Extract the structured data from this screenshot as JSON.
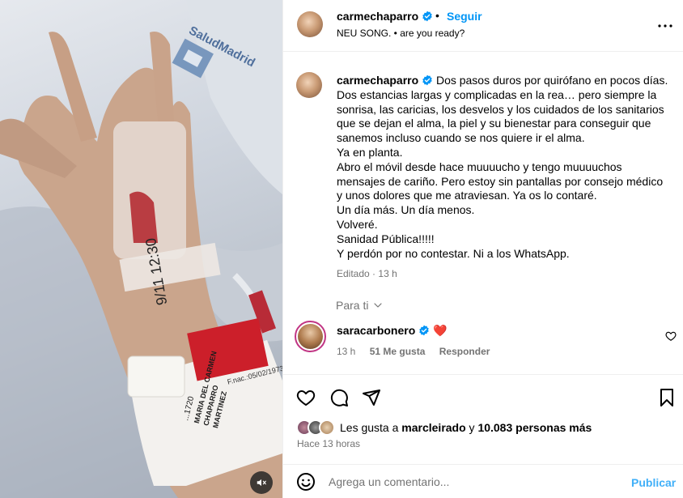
{
  "post": {
    "author": "carmechaparro",
    "follow_label": "Seguir",
    "separator": "•",
    "audio": "NEU SONG. • are you ready?",
    "more_icon": "more-horizontal-icon",
    "verified_color": "#0095f6"
  },
  "media": {
    "mute_icon": "muted-speaker-icon",
    "bracelet_text": [
      "F.nac.:05/02/1973",
      "...1720",
      "MARIA DEL CARMEN",
      "CHAPARRO",
      "MARTINEZ"
    ],
    "bag_text": "9/11 12:30",
    "logo_text": "SaludMadrid"
  },
  "caption": {
    "username": "carmechaparro",
    "lines": [
      "Dos pasos duros por quirófano en pocos días.",
      "Dos estancias largas y complicadas en la rea… pero siempre la",
      "sonrisa, las caricias, los desvelos y los cuidados de los sanitarios",
      "que se dejan el alma, la piel y su bienestar para conseguir que",
      "sanemos incluso cuando se nos quiere ir el alma.",
      "Ya en planta.",
      "Abro el móvil desde hace muuuucho y tengo muuuuchos",
      "mensajes de cariño. Pero estoy sin pantallas por consejo médico",
      "y unos dolores que me atraviesan. Ya os lo contaré.",
      "Un día más. Un día menos.",
      "Volveré.",
      "Sanidad Pública!!!!!",
      "Y perdón por no contestar. Ni a los WhatsApp."
    ],
    "edited": "Editado",
    "time": "13 h"
  },
  "filter": {
    "label": "Para ti"
  },
  "comment": {
    "username": "saracarbonero",
    "emoji": "❤️",
    "time": "13 h",
    "likes": "51 Me gusta",
    "reply": "Responder"
  },
  "likes": {
    "prefix": "Les gusta a",
    "user": "marcleirado",
    "connector": "y",
    "others": "10.083 personas más",
    "time_ago": "Hace 13 horas"
  },
  "add_comment": {
    "placeholder": "Agrega un comentario...",
    "publish": "Publicar"
  },
  "colors": {
    "accent": "#0095f6",
    "secondary_text": "#737373",
    "divider": "#efefef",
    "heart_red": "#ed4956"
  }
}
